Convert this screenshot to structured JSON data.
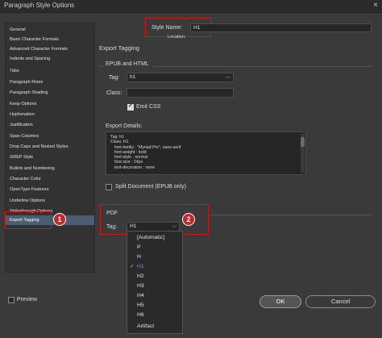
{
  "window": {
    "title": "Paragraph Style Options",
    "close": "×"
  },
  "sidebar": {
    "items": [
      {
        "label": "General"
      },
      {
        "label": "Basic Character Formats"
      },
      {
        "label": "Advanced Character Formats"
      },
      {
        "label": "Indents and Spacing"
      },
      {
        "label": "Tabs"
      },
      {
        "label": "Paragraph Rules"
      },
      {
        "label": "Paragraph Shading"
      },
      {
        "label": "Keep Options"
      },
      {
        "label": "Hyphenation"
      },
      {
        "label": "Justification"
      },
      {
        "label": "Span Columns"
      },
      {
        "label": "Drop Caps and Nested Styles"
      },
      {
        "label": "GREP Style"
      },
      {
        "label": "Bullets and Numbering"
      },
      {
        "label": "Character Color"
      },
      {
        "label": "OpenType Features"
      },
      {
        "label": "Underline Options"
      },
      {
        "label": "Strikethrough Options"
      },
      {
        "label": "Export Tagging",
        "selected": true
      }
    ]
  },
  "header": {
    "style_name_label": "Style Name:",
    "style_name_value": "H1",
    "location_label": "Location:"
  },
  "section": {
    "title": "Export Tagging"
  },
  "epub": {
    "group_label": "EPUB and HTML",
    "tag_label": "Tag:",
    "tag_value": "h1",
    "class_label": "Class:",
    "class_value": "",
    "emit_css_label": "Emit CSS",
    "emit_css_checked": true,
    "export_details_label": "Export Details:",
    "export_details_lines": [
      "Tag: h1",
      "Class: H1",
      "font-family : \"Myriad Pro\", sans-serif",
      "font-weight : bold",
      "font-style : normal",
      "font-size : 24px",
      "text-decoration : none"
    ],
    "split_document_label": "Split Document (EPUB only)",
    "split_document_checked": false
  },
  "pdf": {
    "group_label": "PDF",
    "tag_label": "Tag:",
    "tag_value": "H1",
    "options": [
      "[Automatic]",
      "P",
      "H",
      "H1",
      "H2",
      "H3",
      "H4",
      "H5",
      "H6",
      "Artifact"
    ],
    "selected_index": 3
  },
  "callouts": {
    "one": "1",
    "two": "2"
  },
  "footer": {
    "preview_label": "Preview",
    "preview_checked": false,
    "ok_label": "OK",
    "cancel_label": "Cancel"
  },
  "icons": {
    "chevron": "chevron-down-icon",
    "check": "checkmark-icon",
    "close": "close-icon"
  },
  "colors": {
    "accent": "#c62828",
    "selection": "#4b5d71",
    "current_item": "#5b9be0"
  }
}
